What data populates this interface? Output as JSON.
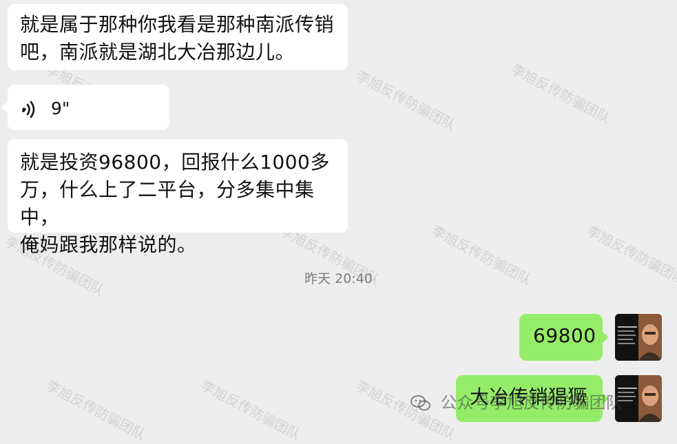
{
  "messages": [
    {
      "side": "left",
      "type": "text",
      "lines": [
        "就是属于那种你我看是那种南派传销",
        "吧，南派就是湖北大冶那边儿。"
      ]
    },
    {
      "side": "left",
      "type": "voice",
      "duration": "9\""
    },
    {
      "side": "left",
      "type": "text",
      "lines": [
        "就是投资96800，回报什么1000多",
        "万，什么上了二平台，分多集中集中，",
        "俺妈跟我那样说的。"
      ]
    },
    {
      "side": "right",
      "type": "text",
      "lines": [
        "69800"
      ]
    },
    {
      "side": "right",
      "type": "text",
      "lines": [
        "大冶传销猖獗"
      ]
    }
  ],
  "timestamp": "昨天 20:40",
  "watermark": "李旭反传防骗团队",
  "footer": {
    "prefix": "公众号",
    "name": "李旭反传防骗团队"
  },
  "colors": {
    "background": "#ededed",
    "incoming": "#ffffff",
    "outgoing": "#95ec69"
  }
}
